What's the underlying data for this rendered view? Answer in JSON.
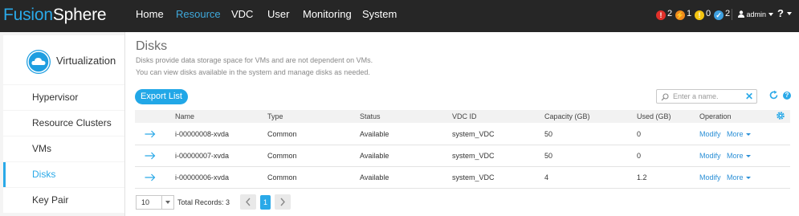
{
  "app": {
    "logo_part1": "Fusion",
    "logo_part2": "Sphere",
    "nav": [
      "Home",
      "Resource",
      "VDC",
      "User",
      "Monitoring",
      "System"
    ],
    "active_nav": "Resource",
    "alarms": [
      {
        "count": "2",
        "color": "#e0302a",
        "icon": "critical-alarm-icon"
      },
      {
        "count": "1",
        "color": "#f08a1c",
        "icon": "major-alarm-icon"
      },
      {
        "count": "0",
        "color": "#f3c411",
        "icon": "minor-alarm-icon"
      },
      {
        "count": "2",
        "color": "#3fa0e0",
        "icon": "warning-alarm-icon"
      }
    ],
    "user": "admin",
    "help": "?"
  },
  "sidebar": {
    "title": "Virtualization",
    "items": [
      {
        "label": "Hypervisor"
      },
      {
        "label": "Resource Clusters"
      },
      {
        "label": "VMs"
      },
      {
        "label": "Disks"
      },
      {
        "label": "Key Pair"
      }
    ],
    "active_item": "Disks"
  },
  "main": {
    "title": "Disks",
    "desc1": "Disks provide data storage space for VMs and are not dependent on VMs.",
    "desc2": "You can view disks available in the system and manage disks as needed.",
    "export_label": "Export List",
    "search_placeholder": "Enter a name.",
    "columns": [
      "Name",
      "Type",
      "Status",
      "VDC ID",
      "Capacity (GB)",
      "Used (GB)",
      "Operation"
    ],
    "rows": [
      {
        "name": "i-00000008-xvda",
        "type": "Common",
        "status": "Available",
        "vdc": "system_VDC",
        "capacity": "50",
        "used": "0",
        "op1": "Modify",
        "op2": "More"
      },
      {
        "name": "i-00000007-xvda",
        "type": "Common",
        "status": "Available",
        "vdc": "system_VDC",
        "capacity": "50",
        "used": "0",
        "op1": "Modify",
        "op2": "More"
      },
      {
        "name": "i-00000006-xvda",
        "type": "Common",
        "status": "Available",
        "vdc": "system_VDC",
        "capacity": "4",
        "used": "1.2",
        "op1": "Modify",
        "op2": "More"
      }
    ],
    "page_size": "10",
    "total_records": "Total Records: 3",
    "current_page": "1"
  },
  "colors": {
    "topbar": "#262626",
    "accent": "#2aa9e8",
    "link": "#2a8fd6"
  }
}
